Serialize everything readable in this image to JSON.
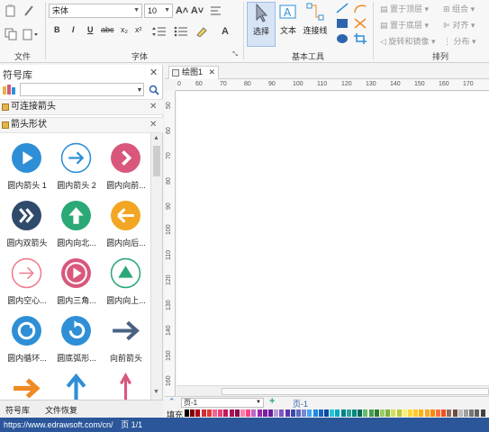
{
  "ribbon": {
    "groups": {
      "file": "文件",
      "font": "字体",
      "basic_tools": "基本工具",
      "arrange": "排列"
    },
    "font_name": "宋体",
    "font_size": "10",
    "font_grow": "A˄",
    "font_shrink": "A˅",
    "format_buttons": [
      "B",
      "I",
      "U",
      "abc",
      "x₂",
      "x²"
    ],
    "tools": {
      "select": "选择",
      "text": "文本",
      "connector": "连接线"
    },
    "arrange": {
      "bring_front": "置于顶层",
      "send_back": "置于底层",
      "rotate_mirror": "旋转和镜像",
      "group": "组合",
      "align": "对齐",
      "distribute": "分布"
    }
  },
  "symbol_panel": {
    "title": "符号库",
    "search_placeholder": "",
    "categories": [
      "可连接箭头",
      "箭头形状"
    ],
    "items": [
      {
        "label": "圆内箭头 1",
        "color": "#2e8fd6",
        "kind": "play"
      },
      {
        "label": "圆内箭头 2",
        "color": "#2e8fd6",
        "kind": "arrow-right-outline"
      },
      {
        "label": "圆内向前...",
        "color": "#d9577c",
        "kind": "chevron-right"
      },
      {
        "label": "圆内双箭头",
        "color": "#2f4a6b",
        "kind": "double-chevron"
      },
      {
        "label": "圆内向北...",
        "color": "#2aa876",
        "kind": "arrow-up"
      },
      {
        "label": "圆内向后...",
        "color": "#f2a623",
        "kind": "arrow-left"
      },
      {
        "label": "圆内空心...",
        "color": "#f07c8e",
        "kind": "arrow-right-hollow"
      },
      {
        "label": "圆内三角...",
        "color": "#d9577c",
        "kind": "play-ring"
      },
      {
        "label": "圆内向上...",
        "color": "#2aa876",
        "kind": "triangle-up"
      },
      {
        "label": "圆内循环...",
        "color": "#2e8fd6",
        "kind": "cycle"
      },
      {
        "label": "圆底弧形...",
        "color": "#2e8fd6",
        "kind": "refresh"
      },
      {
        "label": "向前箭头",
        "color": "#4a6282",
        "kind": "plain-right"
      },
      {
        "label": "",
        "color": "#f08a24",
        "kind": "bold-right"
      },
      {
        "label": "",
        "color": "#2e8fd6",
        "kind": "bold-up"
      },
      {
        "label": "",
        "color": "#d9577c",
        "kind": "thin-up"
      }
    ],
    "tabs": [
      "符号库",
      "文件恢复"
    ]
  },
  "document": {
    "tab_title": "绘图1",
    "ruler_h": [
      "0",
      "60",
      "70",
      "80",
      "90",
      "100",
      "110",
      "120",
      "130",
      "140",
      "150",
      "160",
      "170"
    ],
    "ruler_v": [
      "50",
      "60",
      "70",
      "80",
      "90",
      "100",
      "110",
      "120",
      "130",
      "140",
      "150",
      "160"
    ]
  },
  "page_bar": {
    "page_select": "页-1",
    "page_tab": "页-1"
  },
  "color_bar": {
    "fill_label": "填充",
    "swatches": [
      "#000000",
      "#7f0000",
      "#b00020",
      "#d32f2f",
      "#e53935",
      "#f06292",
      "#ec407a",
      "#c2185b",
      "#ad1457",
      "#880e4f",
      "#ff80ab",
      "#ff4081",
      "#ba68c8",
      "#9c27b0",
      "#7b1fa2",
      "#6a1b9a",
      "#b39ddb",
      "#7e57c2",
      "#5e35b1",
      "#3949ab",
      "#5c6bc0",
      "#7986cb",
      "#42a5f5",
      "#1e88e5",
      "#1565c0",
      "#0d47a1",
      "#26c6da",
      "#00acc1",
      "#00838f",
      "#26a69a",
      "#00897b",
      "#00695c",
      "#66bb6a",
      "#43a047",
      "#2e7d32",
      "#9ccc65",
      "#7cb342",
      "#d4e157",
      "#c0ca33",
      "#fff176",
      "#fdd835",
      "#ffca28",
      "#ffb300",
      "#ffa726",
      "#fb8c00",
      "#ff7043",
      "#f4511e",
      "#8d6e63",
      "#6d4c41",
      "#bdbdbd",
      "#9e9e9e",
      "#757575",
      "#616161",
      "#424242"
    ]
  },
  "status": {
    "url": "https://www.edrawsoft.com/cn/",
    "page_info": "页 1/1"
  },
  "colors": {
    "status_bar": "#2b579a",
    "accent_blue": "#2e8fd6"
  }
}
